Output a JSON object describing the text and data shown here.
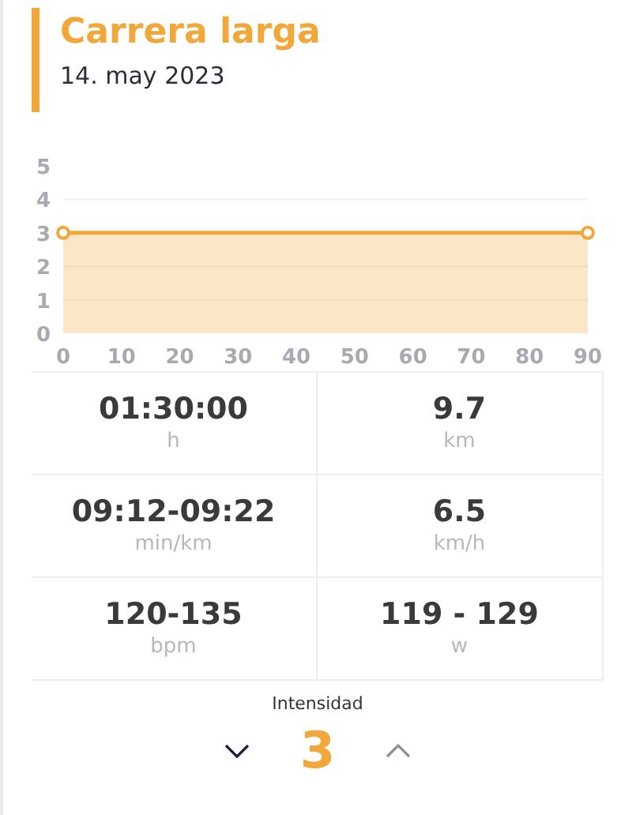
{
  "header": {
    "title": "Carrera larga",
    "date": "14. may 2023"
  },
  "chart_data": {
    "type": "area",
    "x": [
      0,
      90
    ],
    "series": [
      {
        "color": "#f2a73b",
        "values": [
          3,
          3
        ]
      }
    ],
    "grid": true,
    "xlim": [
      0,
      90
    ],
    "ylim": [
      0,
      5
    ],
    "xticks": [
      0,
      10,
      20,
      30,
      40,
      50,
      60,
      70,
      80,
      90
    ],
    "yticks": [
      0,
      1,
      2,
      3,
      4,
      5
    ]
  },
  "stats": [
    {
      "value": "01:30:00",
      "unit": "h"
    },
    {
      "value": "9.7",
      "unit": "km"
    },
    {
      "value": "09:12-09:22",
      "unit": "min/km"
    },
    {
      "value": "6.5",
      "unit": "km/h"
    },
    {
      "value": "120-135",
      "unit": "bpm"
    },
    {
      "value": "119 - 129",
      "unit": "w"
    }
  ],
  "intensity": {
    "label": "Intensidad",
    "value": "3",
    "decrease": {
      "disabled": false
    },
    "increase": {
      "disabled": true
    }
  }
}
